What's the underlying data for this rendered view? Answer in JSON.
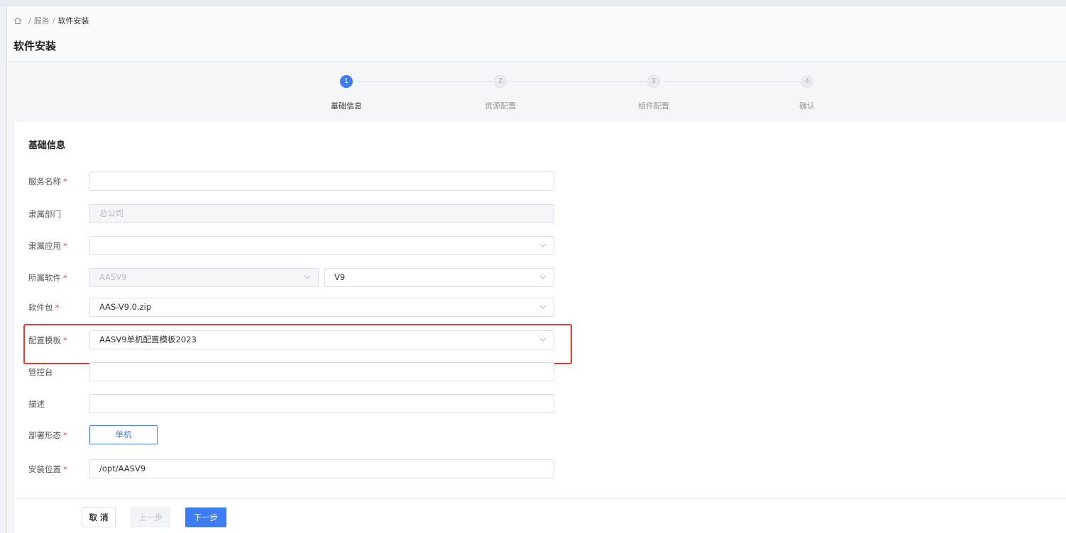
{
  "breadcrumb": {
    "home_icon": "home-icon",
    "items": [
      "服务",
      "软件安装"
    ]
  },
  "page_title": "软件安装",
  "steps": [
    {
      "number": "1",
      "label": "基础信息",
      "active": true
    },
    {
      "number": "2",
      "label": "资源配置",
      "active": false
    },
    {
      "number": "3",
      "label": "组件配置",
      "active": false
    },
    {
      "number": "4",
      "label": "确认",
      "active": false
    }
  ],
  "card_title": "基础信息",
  "form": {
    "service_name": {
      "label": "服务名称",
      "value": ""
    },
    "department": {
      "label": "隶属部门",
      "value": "总公司"
    },
    "application": {
      "label": "隶属应用",
      "value": ""
    },
    "software": {
      "label": "所属软件",
      "name_value": "AASV9",
      "version_value": "V9"
    },
    "package": {
      "label": "软件包",
      "value": "AAS-V9.0.zip"
    },
    "template": {
      "label": "配置模板",
      "value": "AASV9单机配置模板2023"
    },
    "console": {
      "label": "管控台",
      "value": ""
    },
    "description": {
      "label": "描述",
      "value": ""
    },
    "deploy_mode": {
      "label": "部署形态",
      "option": "单机"
    },
    "install_path": {
      "label": "安装位置",
      "value": "/opt/AASV9"
    },
    "required_mark": "*"
  },
  "buttons": {
    "cancel": "取 消",
    "prev": "上一步",
    "next": "下一步"
  },
  "colors": {
    "accent": "#3e7cf5",
    "required": "#e34d59",
    "highlight": "#e53935"
  }
}
